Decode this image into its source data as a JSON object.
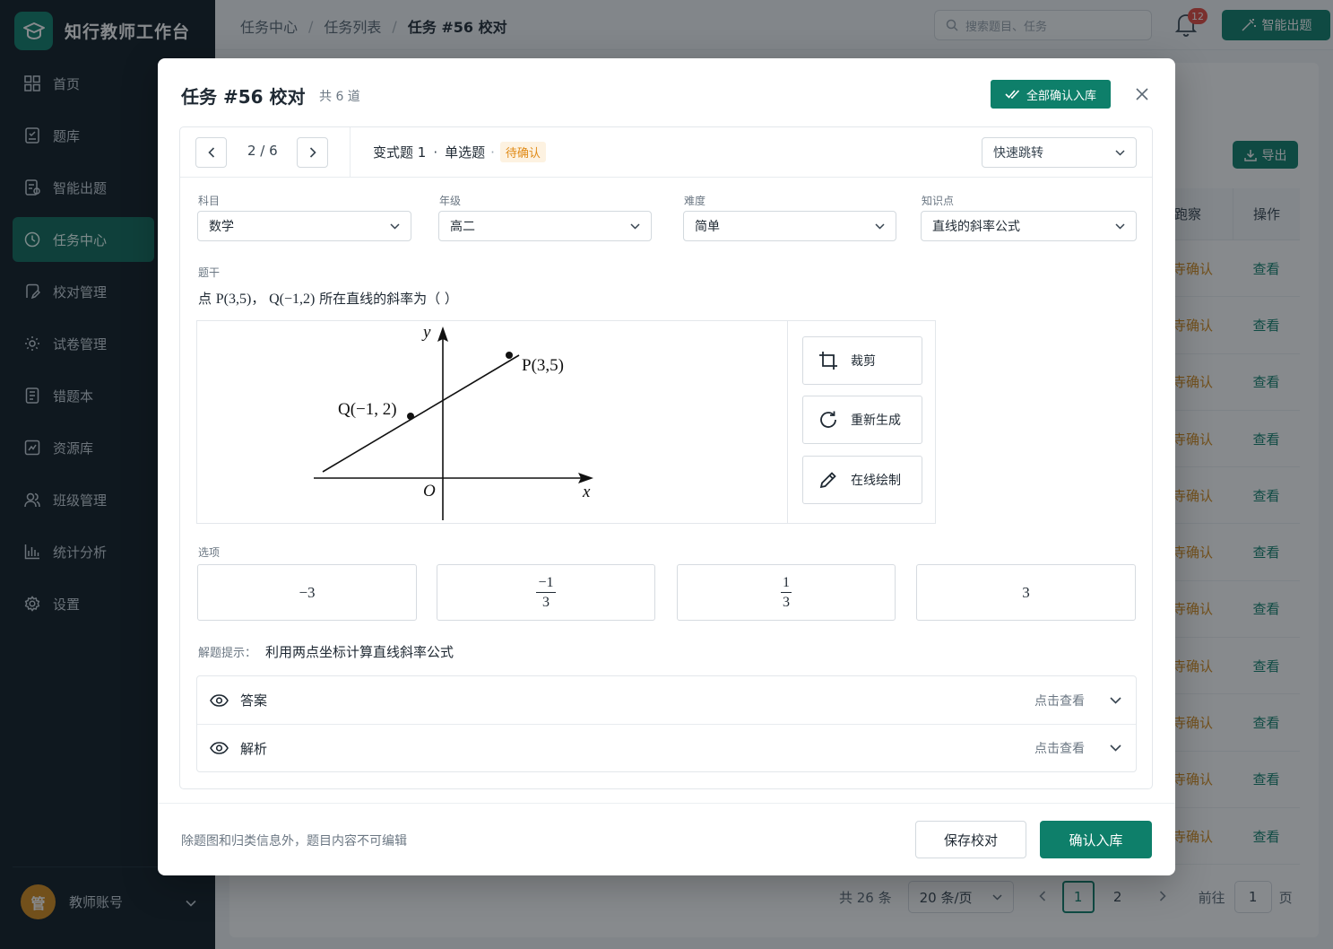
{
  "app": {
    "name": "知行教师工作台",
    "user": {
      "avatar_text": "管",
      "name": "教师账号"
    }
  },
  "sidebar": {
    "items": [
      {
        "label": "首页",
        "icon": "grid-icon"
      },
      {
        "label": "题库",
        "icon": "question-bank-icon"
      },
      {
        "label": "智能出题",
        "icon": "ai-document-icon"
      },
      {
        "label": "任务中心",
        "icon": "task-center-icon",
        "active": true
      },
      {
        "label": "校对管理",
        "icon": "proofread-icon"
      },
      {
        "label": "试卷管理",
        "icon": "gear-paper-icon"
      },
      {
        "label": "错题本",
        "icon": "notebook-icon"
      },
      {
        "label": "资源库",
        "icon": "resource-icon"
      },
      {
        "label": "班级管理",
        "icon": "users-icon"
      },
      {
        "label": "统计分析",
        "icon": "bar-chart-icon"
      },
      {
        "label": "设置",
        "icon": "settings-icon"
      }
    ]
  },
  "header": {
    "breadcrumb": [
      "任务中心",
      "任务列表",
      "任务 #56 校对"
    ],
    "search_placeholder": "搜索题目、任务",
    "notifications": "12",
    "ai_button": "智能出题"
  },
  "background": {
    "export_label": "导出",
    "table_headers": [
      "跑察",
      "操作"
    ],
    "rows": [
      {
        "status": "寺确认",
        "action": "查看"
      },
      {
        "status": "寺确认",
        "action": "查看"
      },
      {
        "status": "寺确认",
        "action": "查看"
      },
      {
        "status": "寺确认",
        "action": "查看"
      },
      {
        "status": "寺确认",
        "action": "查看"
      },
      {
        "status": "寺确认",
        "action": "查看"
      },
      {
        "status": "寺确认",
        "action": "查看"
      },
      {
        "status": "寺确认",
        "action": "查看"
      },
      {
        "status": "寺确认",
        "action": "查看"
      },
      {
        "status": "寺确认",
        "action": "查看"
      },
      {
        "status": "寺确认",
        "action": "查看"
      }
    ],
    "pagination": {
      "total": "共 26 条",
      "page_size": "20 条/页",
      "pages": [
        "1",
        "2"
      ],
      "current": "1",
      "goto_label": "前往",
      "goto_value": "1",
      "page_unit": "页"
    }
  },
  "modal": {
    "title": "任务 #56 校对",
    "count": "共 6 道",
    "confirm_all": "全部确认入库",
    "position": "2 / 6",
    "question_kind": "变式题 1",
    "question_type": "单选题",
    "status": "待确认",
    "quick_jump": "快速跳转",
    "fields": {
      "subject": {
        "label": "科目",
        "value": "数学"
      },
      "grade": {
        "label": "年级",
        "value": "高二"
      },
      "difficulty": {
        "label": "难度",
        "value": "简单"
      },
      "knowledge": {
        "label": "知识点",
        "value": "直线的斜率公式"
      }
    },
    "stem_label": "题干",
    "stem": {
      "prefix": "点 ",
      "p": "P(3,5)",
      "mid": "， ",
      "q": "Q(−1,2)",
      "suffix": " 所在直线的斜率为（    ）"
    },
    "figure": {
      "label_y": "y",
      "label_x": "x",
      "label_o": "O",
      "label_p": "P(3,5)",
      "label_q": "Q(−1, 2)"
    },
    "tools": [
      "裁剪",
      "重新生成",
      "在线绘制"
    ],
    "options_label": "选项",
    "options": [
      {
        "text": "−3"
      },
      {
        "num": "−1",
        "den": "3"
      },
      {
        "num": "1",
        "den": "3"
      },
      {
        "text": "3"
      }
    ],
    "hint_label": "解题提示：",
    "hint": "利用两点坐标计算直线斜率公式",
    "answer_label": "答案",
    "analysis_label": "解析",
    "peek_label": "点击查看",
    "footnote": "除题图和归类信息外，题目内容不可编辑",
    "save": "保存校对",
    "confirm": "确认入库"
  },
  "colors": {
    "accent": "#0e7f6a",
    "warning": "#e08a16",
    "sidebar_bg": "#0f1b23",
    "badge": "#e5483f"
  }
}
